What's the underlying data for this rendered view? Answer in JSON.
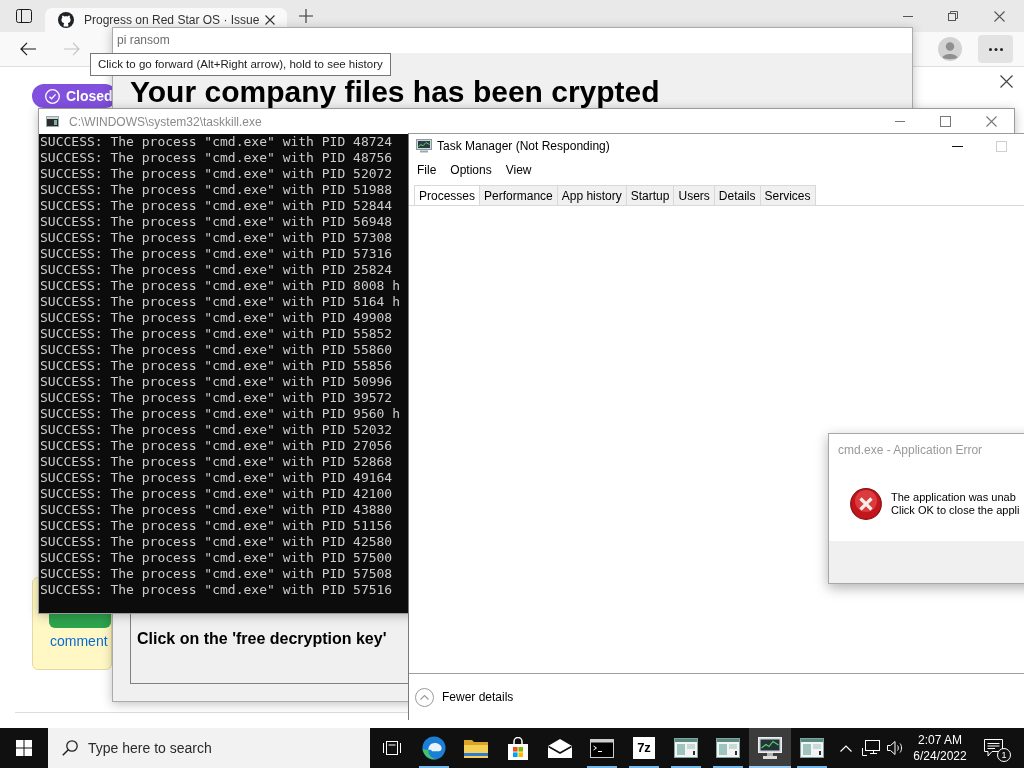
{
  "browser": {
    "tab_title": "Progress on Red Star OS · Issue",
    "forward_disabled": true,
    "status_badge": "Closed",
    "comment_link": "comment"
  },
  "tooltip": {
    "text": "Click to go forward (Alt+Right arrow), hold to see history"
  },
  "ransom_window": {
    "title": "pi ransom",
    "heading": "Your company files has been crypted",
    "instruction": "Click on the 'free decryption key'"
  },
  "console_window": {
    "title": "C:\\WINDOWS\\system32\\taskkill.exe",
    "lines": [
      "SUCCESS: The process \"cmd.exe\" with PID 48724",
      "SUCCESS: The process \"cmd.exe\" with PID 48756",
      "SUCCESS: The process \"cmd.exe\" with PID 52072",
      "SUCCESS: The process \"cmd.exe\" with PID 51988",
      "SUCCESS: The process \"cmd.exe\" with PID 52844",
      "SUCCESS: The process \"cmd.exe\" with PID 56948",
      "SUCCESS: The process \"cmd.exe\" with PID 57308",
      "SUCCESS: The process \"cmd.exe\" with PID 57316",
      "SUCCESS: The process \"cmd.exe\" with PID 25824",
      "SUCCESS: The process \"cmd.exe\" with PID 8008 h",
      "SUCCESS: The process \"cmd.exe\" with PID 5164 h",
      "SUCCESS: The process \"cmd.exe\" with PID 49908",
      "SUCCESS: The process \"cmd.exe\" with PID 55852",
      "SUCCESS: The process \"cmd.exe\" with PID 55860",
      "SUCCESS: The process \"cmd.exe\" with PID 55856",
      "SUCCESS: The process \"cmd.exe\" with PID 50996",
      "SUCCESS: The process \"cmd.exe\" with PID 39572",
      "SUCCESS: The process \"cmd.exe\" with PID 9560 h",
      "SUCCESS: The process \"cmd.exe\" with PID 52032",
      "SUCCESS: The process \"cmd.exe\" with PID 27056",
      "SUCCESS: The process \"cmd.exe\" with PID 52868",
      "SUCCESS: The process \"cmd.exe\" with PID 49164",
      "SUCCESS: The process \"cmd.exe\" with PID 42100",
      "SUCCESS: The process \"cmd.exe\" with PID 43880",
      "SUCCESS: The process \"cmd.exe\" with PID 51156",
      "SUCCESS: The process \"cmd.exe\" with PID 42580",
      "SUCCESS: The process \"cmd.exe\" with PID 57500",
      "SUCCESS: The process \"cmd.exe\" with PID 57508",
      "SUCCESS: The process \"cmd.exe\" with PID 57516"
    ]
  },
  "task_manager": {
    "title": "Task Manager (Not Responding)",
    "menu": [
      "File",
      "Options",
      "View"
    ],
    "tabs": [
      {
        "label": "Processes",
        "selected": true
      },
      {
        "label": "Performance",
        "selected": false
      },
      {
        "label": "App history",
        "selected": false
      },
      {
        "label": "Startup",
        "selected": false
      },
      {
        "label": "Users",
        "selected": false
      },
      {
        "label": "Details",
        "selected": false
      },
      {
        "label": "Services",
        "selected": false
      }
    ],
    "footer_button": "Fewer details"
  },
  "error_dialog": {
    "title": "cmd.exe - Application Error",
    "message_lines": [
      "The application was unab",
      "Click OK to close the appli"
    ]
  },
  "taskbar": {
    "search": {
      "placeholder": "Type here to search"
    },
    "apps": [
      {
        "kind": "browser",
        "running": true,
        "selected": false
      },
      {
        "kind": "folder",
        "running": false,
        "selected": false
      },
      {
        "kind": "store",
        "running": false,
        "selected": false
      },
      {
        "kind": "mail",
        "running": false,
        "selected": false
      },
      {
        "kind": "console",
        "running": true,
        "selected": false
      },
      {
        "kind": "archiver",
        "label": "7z",
        "running": true,
        "selected": false
      },
      {
        "kind": "window",
        "running": true,
        "selected": false
      },
      {
        "kind": "window",
        "running": true,
        "selected": false
      },
      {
        "kind": "monitor",
        "running": true,
        "selected": true
      },
      {
        "kind": "window",
        "running": true,
        "selected": false
      }
    ],
    "time": "2:07 AM",
    "date": "6/24/2022",
    "notification_count": "1"
  }
}
